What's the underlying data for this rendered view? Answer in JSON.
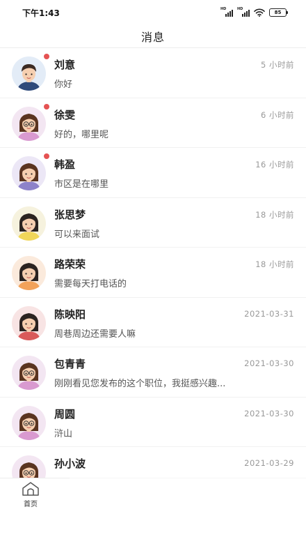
{
  "status_bar": {
    "time": "下午1:43",
    "battery": "85",
    "signal_label": "HD"
  },
  "header": {
    "title": "消息"
  },
  "messages": [
    {
      "name": "刘意",
      "time": "5 小时前",
      "preview": "你好",
      "unread": true,
      "avatar": "man"
    },
    {
      "name": "徐雯",
      "time": "6 小时前",
      "preview": "好的，哪里呢",
      "unread": true,
      "avatar": "woman-glasses"
    },
    {
      "name": "韩盈",
      "time": "16 小时前",
      "preview": "市区是在哪里",
      "unread": true,
      "avatar": "woman-purple"
    },
    {
      "name": "张思梦",
      "time": "18 小时前",
      "preview": "可以来面试",
      "unread": false,
      "avatar": "woman-yellow"
    },
    {
      "name": "路荣荣",
      "time": "18 小时前",
      "preview": "需要每天打电话的",
      "unread": false,
      "avatar": "woman-orange"
    },
    {
      "name": "陈映阳",
      "time": "2021-03-31",
      "preview": "周巷周边还需要人嘛",
      "unread": false,
      "avatar": "woman-red"
    },
    {
      "name": "包青青",
      "time": "2021-03-30",
      "preview": "刚刚看见您发布的这个职位，我挺感兴趣...",
      "unread": false,
      "avatar": "woman-glasses"
    },
    {
      "name": "周圆",
      "time": "2021-03-30",
      "preview": "浒山",
      "unread": false,
      "avatar": "woman-glasses"
    },
    {
      "name": "孙小波",
      "time": "2021-03-29",
      "preview": "",
      "unread": false,
      "avatar": "woman-glasses"
    }
  ],
  "tab_bar": {
    "home_label": "首页",
    "home_icon": "home-icon"
  },
  "colors": {
    "unread_dot": "#e55353",
    "time_text": "#999999"
  }
}
